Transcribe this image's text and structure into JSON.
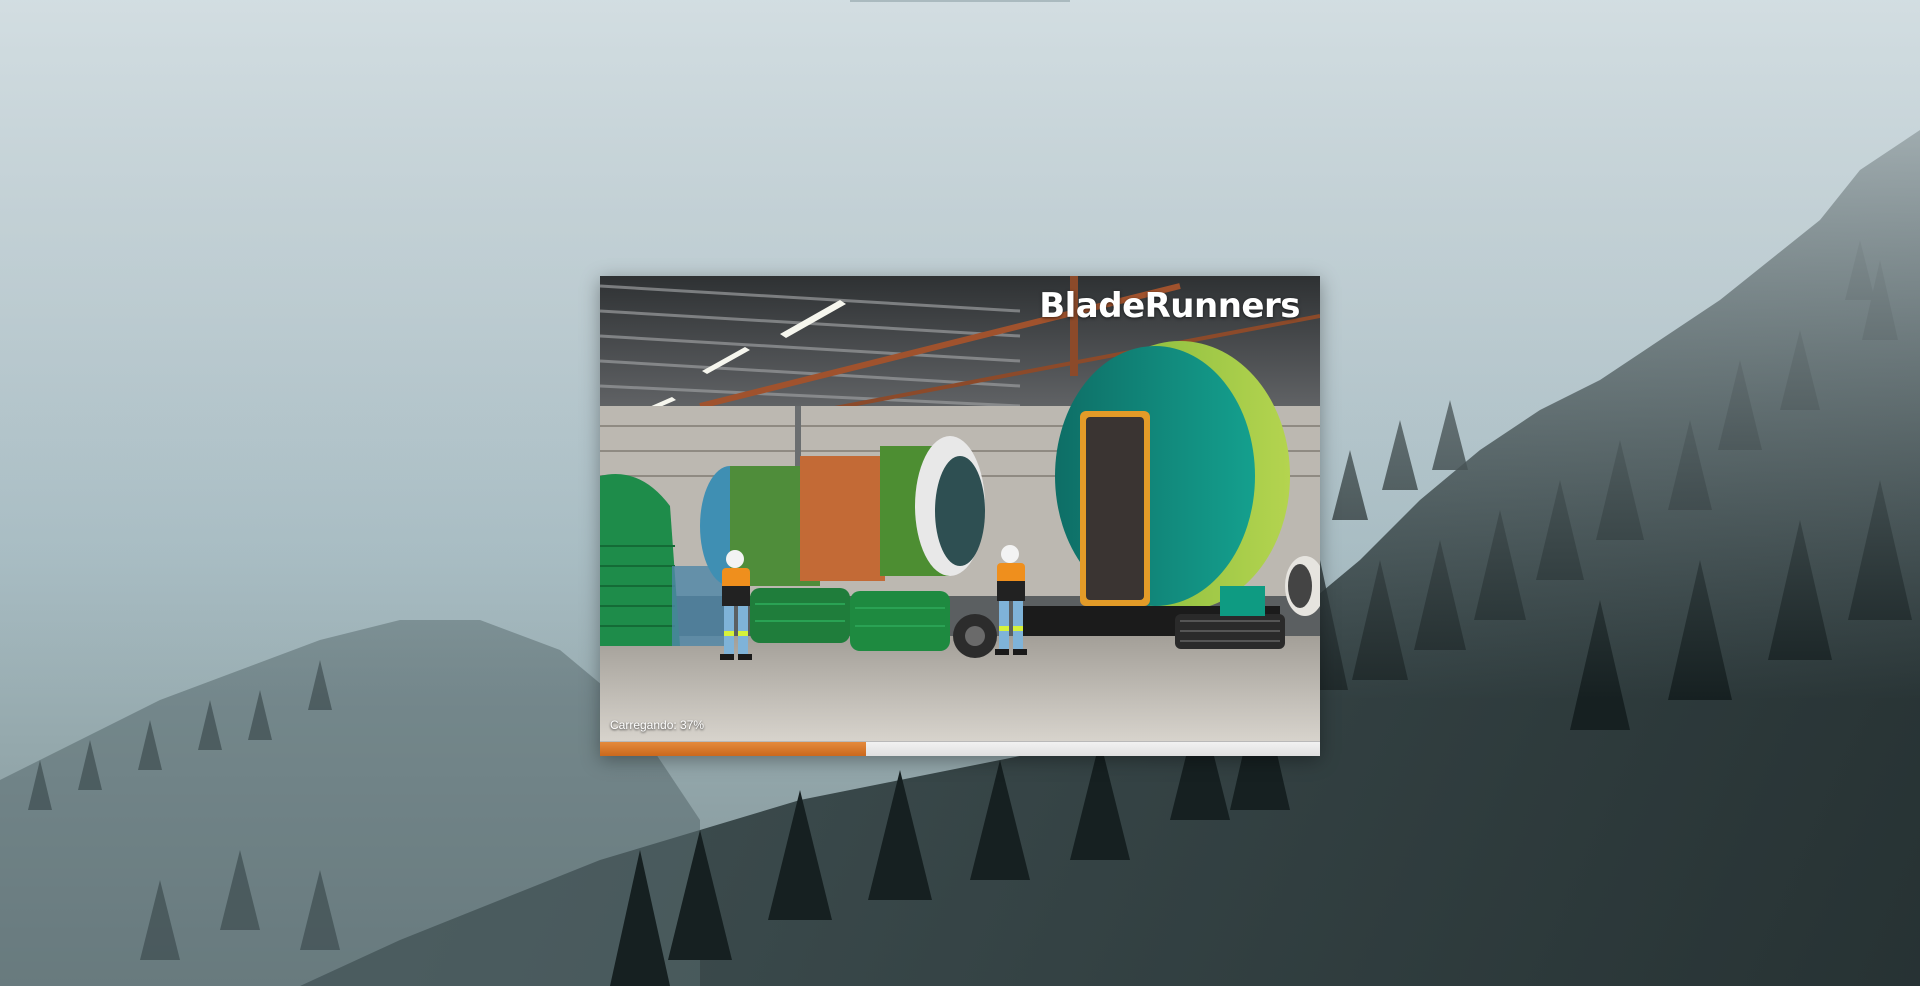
{
  "app": {
    "title": "BladeRunners"
  },
  "loading": {
    "label": "Carregando: 37%",
    "progress_percent": 37
  },
  "colors": {
    "progress_accent": "#d7742a",
    "progress_track": "#e6e6e6",
    "title_text": "#ffffff"
  },
  "wallpaper": {
    "description_icon": "misty-forest-wallpaper"
  }
}
